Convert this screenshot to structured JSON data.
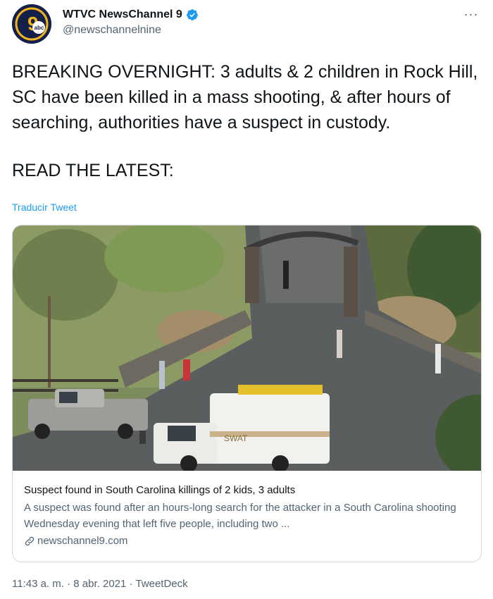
{
  "tweet": {
    "author": {
      "display_name": "WTVC NewsChannel 9",
      "handle": "@newschannelnine",
      "avatar_text": "9",
      "avatar_badge": "abc",
      "verified": true
    },
    "more_label": "···",
    "text_lines": [
      "BREAKING OVERNIGHT: 3 adults & 2 children in Rock Hill, SC have been killed in a mass shooting, & after hours of searching, authorities have a suspect in custody.",
      "READ THE LATEST:"
    ],
    "translate_label": "Traducir Tweet",
    "card": {
      "image_overlay_text": "SWAT",
      "title": "Suspect found in South Carolina killings of 2 kids, 3 adults",
      "description": "A suspect was found after an hours-long search for the attacker in a South Carolina shooting Wednesday evening that left five people, including two ...",
      "domain": "newschannel9.com"
    },
    "time": "11:43 a. m.",
    "date": "8 abr. 2021",
    "source": "TweetDeck",
    "separator": "·"
  },
  "colors": {
    "accent": "#1d9bf0",
    "secondary_text": "#536471",
    "border": "#cfd9de"
  }
}
